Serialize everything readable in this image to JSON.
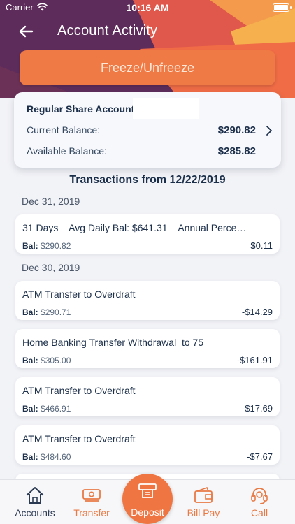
{
  "status_bar": {
    "carrier": "Carrier",
    "time": "10:16 AM"
  },
  "header": {
    "title": "Account Activity",
    "freeze_label": "Freeze/Unfreeze"
  },
  "account": {
    "name": "Regular Share Account",
    "current_label": "Current Balance:",
    "current_value": "$290.82",
    "available_label": "Available Balance:",
    "available_value": "$285.82"
  },
  "transactions_heading": "Transactions from 12/22/2019",
  "groups": [
    {
      "date": "Dec 31, 2019"
    },
    {
      "date": "Dec 30, 2019"
    }
  ],
  "transactions": [
    {
      "desc": "31 Days    Avg Daily Bal: $641.31    Annual Perce…",
      "bal_label": "Bal:",
      "bal": "$290.82",
      "amount": "$0.11"
    },
    {
      "desc": "ATM Transfer to Overdraft",
      "bal_label": "Bal:",
      "bal": "$290.71",
      "amount": "-$14.29"
    },
    {
      "desc": "Home Banking Transfer Withdrawal  to 75",
      "bal_label": "Bal:",
      "bal": "$305.00",
      "amount": "-$161.91"
    },
    {
      "desc": "ATM Transfer to Overdraft",
      "bal_label": "Bal:",
      "bal": "$466.91",
      "amount": "-$17.69"
    },
    {
      "desc": "ATM Transfer to Overdraft",
      "bal_label": "Bal:",
      "bal": "$484.60",
      "amount": "-$7.67"
    }
  ],
  "tabs": [
    {
      "label": "Accounts",
      "icon": "home-icon"
    },
    {
      "label": "Transfer",
      "icon": "money-icon"
    },
    {
      "label": "Deposit",
      "icon": "atm-icon"
    },
    {
      "label": "Bill Pay",
      "icon": "wallet-icon"
    },
    {
      "label": "Call",
      "icon": "headset-icon"
    }
  ],
  "colors": {
    "accent": "#ef7642",
    "header_purple": "#5b2b5a",
    "header_orange": "#f5a646",
    "text_dark": "#1c2f4a"
  }
}
